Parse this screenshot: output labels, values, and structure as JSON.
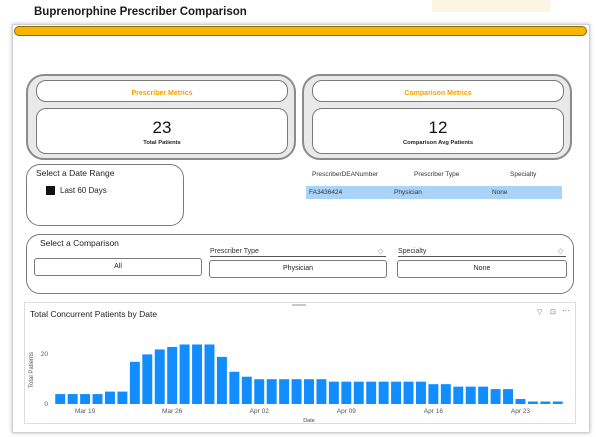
{
  "title": "Buprenorphine Prescriber Comparison",
  "prescriber_metrics": {
    "header": "Prescriber Metrics",
    "value": "23",
    "label": "Total Patients"
  },
  "comparison_metrics": {
    "header": "Comparison Metrics",
    "value": "12",
    "label": "Comparison Avg Patients"
  },
  "date_range": {
    "title": "Select a Date Range",
    "option": "Last 60 Days"
  },
  "table": {
    "headers": [
      "PrescriberDEANumber",
      "Prescriber Type",
      "Specialty"
    ],
    "row": [
      "FA3436424",
      "Physician",
      "None"
    ]
  },
  "comparison": {
    "title": "Select a Comparison",
    "all_label": "All",
    "type_label": "Prescriber Type",
    "type_value": "Physician",
    "specialty_label": "Specialty",
    "specialty_value": "None"
  },
  "chart_data": {
    "type": "bar",
    "title": "Total Concurrent Patients by Date",
    "xlabel": "Date",
    "ylabel": "Total Patients",
    "ylim": [
      0,
      25
    ],
    "yticks": [
      "0",
      "20"
    ],
    "xticks": [
      "Mar 19",
      "Mar 26",
      "Apr 02",
      "Apr 09",
      "Apr 16",
      "Apr 23"
    ],
    "color": "#118dff",
    "values": [
      4,
      4,
      4,
      4,
      5,
      5,
      17,
      20,
      22,
      23,
      24,
      24,
      24,
      19,
      13,
      11,
      10,
      10,
      10,
      10,
      10,
      10,
      9,
      9,
      9,
      9,
      9,
      9,
      9,
      9,
      8,
      8,
      7,
      7,
      7,
      6,
      6,
      2,
      1,
      1,
      1
    ]
  },
  "colors": {
    "accent": "#f7b500",
    "bar": "#118dff",
    "highlight": "#a9d3f7"
  }
}
